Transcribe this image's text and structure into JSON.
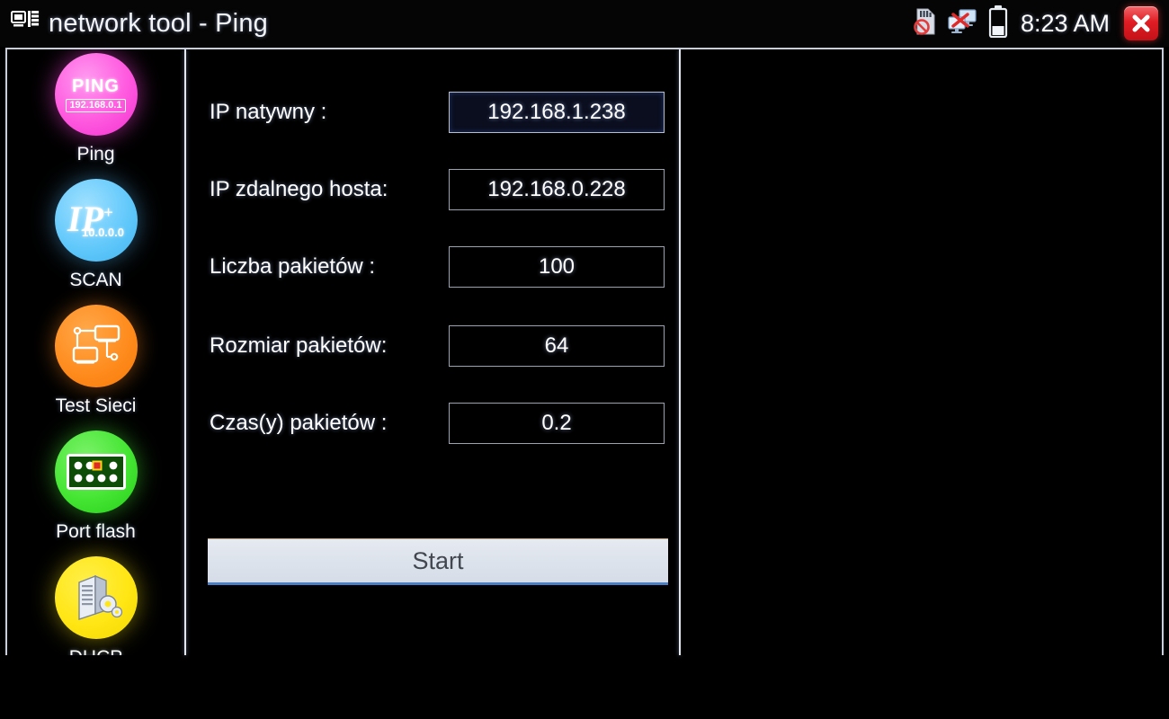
{
  "titlebar": {
    "icon": "network-devices-icon",
    "title": "network tool - Ping",
    "status": {
      "sd_card": "sd-card-disabled-icon",
      "network": "network-disconnected-icon",
      "battery": "battery-icon",
      "clock": "8:23 AM"
    },
    "close_label": "close-icon"
  },
  "sidebar": {
    "items": [
      {
        "label": "Ping",
        "icon": "ping-icon",
        "color": "#ff5ce0",
        "glyph_title": "PING",
        "glyph_sub": "192.168.0.1",
        "selected": true
      },
      {
        "label": "SCAN",
        "icon": "ip-scan-icon",
        "color": "#63c9fb",
        "glyph_title": "IP",
        "glyph_sub": "10.0.0.0",
        "selected": false
      },
      {
        "label": "Test Sieci",
        "icon": "network-test-icon",
        "color": "#ff8c1e",
        "glyph_title": "",
        "glyph_sub": "",
        "selected": false
      },
      {
        "label": "Port flash",
        "icon": "port-flash-icon",
        "color": "#46e534",
        "glyph_title": "",
        "glyph_sub": "",
        "selected": false
      },
      {
        "label": "DHCP",
        "icon": "dhcp-server-icon",
        "color": "#ffe614",
        "glyph_title": "",
        "glyph_sub": "",
        "selected": false
      }
    ]
  },
  "form": {
    "fields": [
      {
        "label": "IP natywny :",
        "value": "192.168.1.238",
        "focused": true
      },
      {
        "label": "IP zdalnego hosta:",
        "value": "192.168.0.228",
        "focused": false
      },
      {
        "label": "Liczba pakietów :",
        "value": "100",
        "focused": false
      },
      {
        "label": "Rozmiar pakietów:",
        "value": "64",
        "focused": false
      },
      {
        "label": "Czas(y) pakietów :",
        "value": "0.2",
        "focused": false
      }
    ],
    "start_label": "Start"
  },
  "results": {
    "content": ""
  },
  "colors": {
    "background": "#000000",
    "border": "#c9cfda",
    "divider": "#e3e8f0",
    "text": "#ffffff",
    "close_button": "#e01d24",
    "start_button": "#dde3ec",
    "focused_field": "#0a0e1e"
  }
}
